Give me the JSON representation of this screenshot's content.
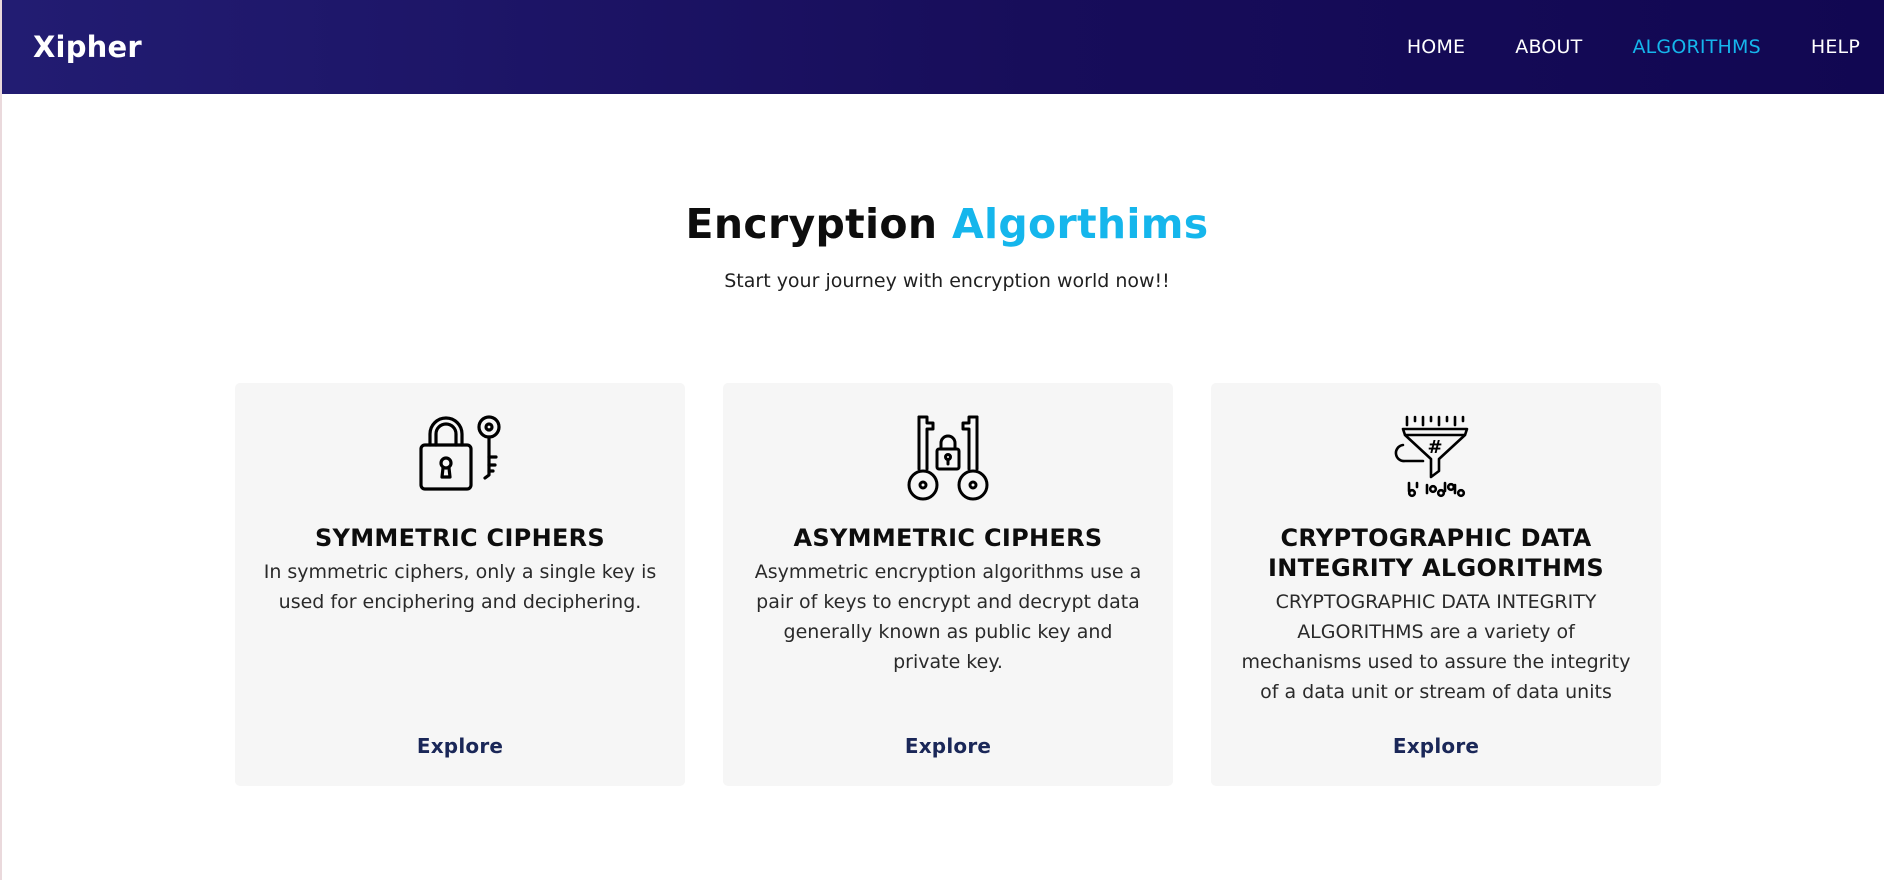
{
  "header": {
    "brand": "Xipher",
    "nav": [
      {
        "label": "HOME",
        "active": false
      },
      {
        "label": "ABOUT",
        "active": false
      },
      {
        "label": "ALGORITHMS",
        "active": true
      },
      {
        "label": "HELP",
        "active": false
      }
    ]
  },
  "hero": {
    "title_part1": "Encryption",
    "title_part2": "Algorthims",
    "subtitle": "Start your journey with encryption world now!!"
  },
  "cards": [
    {
      "icon": "padlock-key-icon",
      "title": "SYMMETRIC CIPHERS",
      "description": "In symmetric ciphers, only a single key is used for enciphering and deciphering.",
      "link": "Explore"
    },
    {
      "icon": "two-keys-lock-icon",
      "title": "ASYMMETRIC CIPHERS",
      "description": "Asymmetric encryption algorithms use a pair of keys to encrypt and decrypt data generally known as public key and private key.",
      "link": "Explore"
    },
    {
      "icon": "data-filter-hash-icon",
      "title": "CRYPTOGRAPHIC DATA INTEGRITY ALGORITHMS",
      "description": "CRYPTOGRAPHIC DATA INTEGRITY ALGORITHMS are a variety of mechanisms used to assure the integrity of a data unit or stream of data units",
      "link": "Explore"
    }
  ],
  "colors": {
    "accent": "#15b6ec",
    "navbar": "#170d5a",
    "card_bg": "#f6f6f6",
    "link": "#1a2758"
  }
}
